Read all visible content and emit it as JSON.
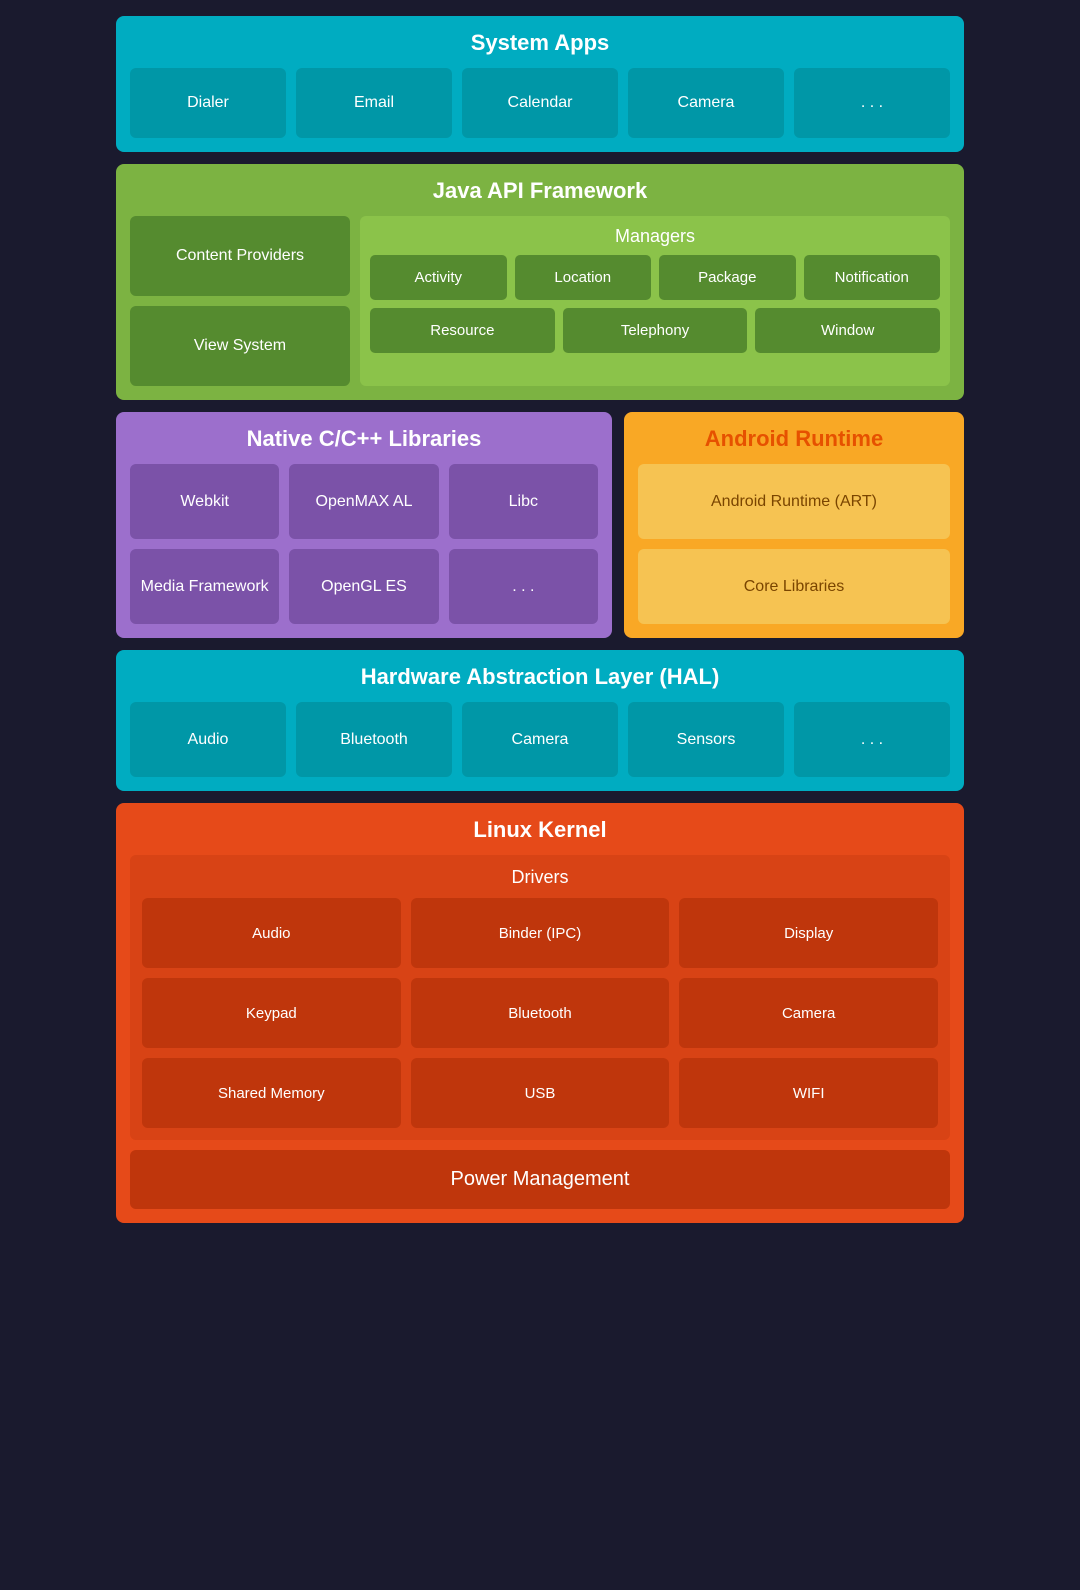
{
  "system_apps": {
    "title": "System Apps",
    "cells": [
      "Dialer",
      "Email",
      "Calendar",
      "Camera",
      ". . ."
    ]
  },
  "java_api": {
    "title": "Java API Framework",
    "left": [
      "Content Providers",
      "View System"
    ],
    "managers_title": "Managers",
    "managers_row1": [
      "Activity",
      "Location",
      "Package",
      "Notification"
    ],
    "managers_row2": [
      "Resource",
      "Telephony",
      "Window"
    ]
  },
  "native_libs": {
    "title": "Native C/C++ Libraries",
    "cells": [
      "Webkit",
      "OpenMAX AL",
      "Libc",
      "Media Framework",
      "OpenGL ES",
      ". . ."
    ]
  },
  "android_runtime": {
    "title": "Android Runtime",
    "cells": [
      "Android Runtime (ART)",
      "Core Libraries"
    ]
  },
  "hal": {
    "title": "Hardware Abstraction Layer (HAL)",
    "cells": [
      "Audio",
      "Bluetooth",
      "Camera",
      "Sensors",
      ". . ."
    ]
  },
  "linux_kernel": {
    "title": "Linux Kernel",
    "drivers_title": "Drivers",
    "drivers": [
      "Audio",
      "Binder (IPC)",
      "Display",
      "Keypad",
      "Bluetooth",
      "Camera",
      "Shared Memory",
      "USB",
      "WIFI"
    ],
    "power_management": "Power Management"
  }
}
